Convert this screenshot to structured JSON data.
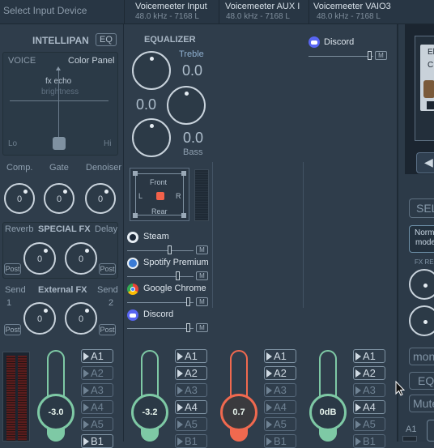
{
  "top_bar": {
    "select_input": "Select Input Device",
    "strips": [
      {
        "name": "Voicemeeter Input",
        "format": "48.0 kHz - 7168 L"
      },
      {
        "name": "Voicemeeter AUX I",
        "format": "48.0 kHz - 7168 L"
      },
      {
        "name": "Voicemeeter VAIO3",
        "format": "48.0 kHz - 7168 L"
      }
    ]
  },
  "intellipan": {
    "title": "INTELLIPAN",
    "eq_button": "EQ",
    "mode": "VOICE",
    "color_panel": "Color Panel",
    "fx_echo": "fx echo",
    "brightness": "brightness",
    "lo": "Lo",
    "hi": "Hi"
  },
  "dynamics": {
    "labels": [
      "Comp.",
      "Gate",
      "Denoiser"
    ],
    "values": [
      "0",
      "0",
      "0"
    ]
  },
  "special_fx": {
    "title": "SPECIAL FX",
    "reverb": "Reverb",
    "delay": "Delay",
    "values": [
      "0",
      "0"
    ],
    "post": "Post"
  },
  "external_fx": {
    "title": "External FX",
    "send_label": "Send",
    "send_1": "1",
    "send_2": "2",
    "values": [
      "0",
      "0"
    ],
    "post": "Post"
  },
  "equalizer": {
    "title": "EQUALIZER",
    "treble": "Treble",
    "treble_value": "0.0",
    "mid_value": "0.0",
    "bass_value": "0.0",
    "bass": "Bass"
  },
  "panner": {
    "front": "Front",
    "rear": "Rear",
    "left": "L",
    "right": "R"
  },
  "app_list": [
    {
      "name": "Steam",
      "mute": "M"
    },
    {
      "name": "Spotify Premium",
      "mute": "M"
    },
    {
      "name": "Google Chrome",
      "mute": "M"
    },
    {
      "name": "Discord",
      "mute": "M"
    }
  ],
  "vaio3_app": {
    "name": "Discord",
    "mute": "M"
  },
  "faders": [
    {
      "value": "-3.0",
      "level": 0.32,
      "color": "#7ec9a5"
    },
    {
      "value": "-3.2",
      "level": 0.32,
      "color": "#7ec9a5"
    },
    {
      "value": "0.7",
      "level": 0.32,
      "color": "#f0694f"
    },
    {
      "value": "0dB",
      "level": 0.32,
      "color": "#7ec9a5"
    }
  ],
  "bus_buttons": [
    {
      "labels": [
        "A1",
        "A2",
        "A3",
        "A4",
        "A5",
        "B1"
      ],
      "active": [
        true,
        false,
        false,
        false,
        false,
        true
      ]
    },
    {
      "labels": [
        "A1",
        "A2",
        "A3",
        "A4",
        "A5",
        "B1"
      ],
      "active": [
        true,
        true,
        false,
        true,
        false,
        false
      ]
    },
    {
      "labels": [
        "A1",
        "A2",
        "A3",
        "A4",
        "A5",
        "B1"
      ],
      "active": [
        true,
        true,
        false,
        false,
        false,
        false
      ]
    },
    {
      "labels": [
        "A1",
        "A2",
        "A3",
        "A4",
        "A5",
        "B1"
      ],
      "active": [
        true,
        true,
        false,
        true,
        false,
        false
      ]
    }
  ],
  "right_panel": {
    "device_label_1": "El",
    "device_label_2": "C:",
    "select": "SEL",
    "mode_1": "Norm",
    "mode_2": "mode",
    "fx_return": "FX RE",
    "mono": "mon",
    "eq": "EQ",
    "mute": "Mute",
    "a1": "A1"
  },
  "colors": {
    "background": "#2f3d4b",
    "fader_green": "#7ec9a5",
    "fader_red": "#f0694f",
    "discord": "#5865f2"
  }
}
